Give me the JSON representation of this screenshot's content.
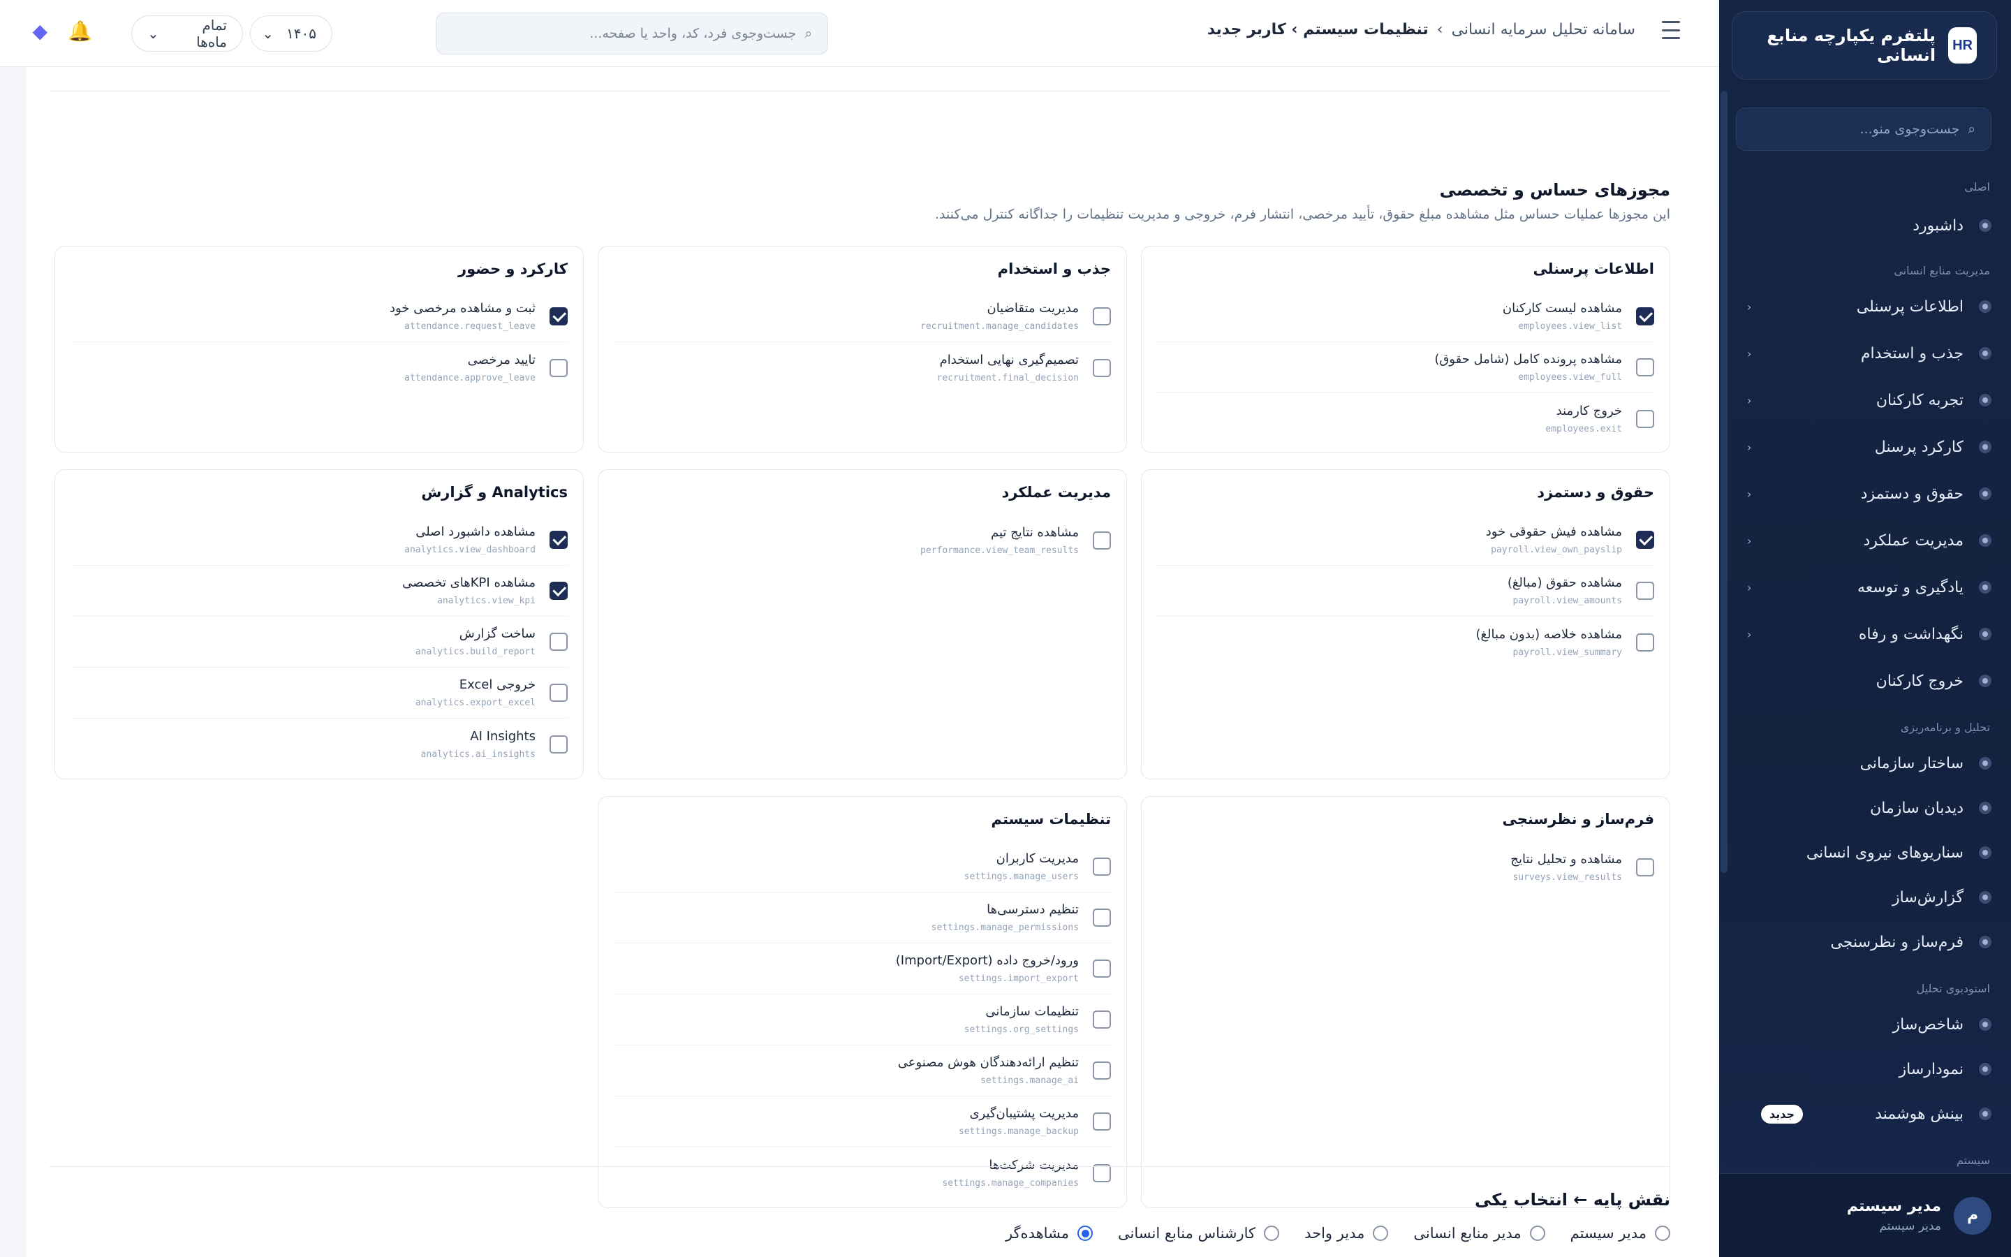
{
  "sidebar": {
    "brand_logo": "HR",
    "brand_title": "پلتفرم یکپارچه منابع انسانی",
    "search_placeholder": "جست‌وجوی منو...",
    "sections": {
      "main": "اصلی",
      "hr": "مدیریت منابع انسانی",
      "analysis": "تحلیل و برنامه‌ریزی",
      "studio": "استودیوی تحلیل",
      "system": "سیستم"
    },
    "items": {
      "dashboard": "داشبورد",
      "personnel": "اطلاعات پرسنلی",
      "recruitment": "جذب و استخدام",
      "experience": "تجربه کارکنان",
      "attendance": "کارکرد پرسنل",
      "payroll": "حقوق و دستمزد",
      "performance": "مدیریت عملکرد",
      "learning": "یادگیری و توسعه",
      "retention": "نگهداشت و رفاه",
      "exit": "خروج کارکنان",
      "org": "ساختار سازمانی",
      "orgview": "دیدبان سازمان",
      "scenarios": "سناریوهای نیروی انسانی",
      "reports": "گزارش‌ساز",
      "forms": "فرم‌ساز و نظرسنجی",
      "kpi": "شاخص‌ساز",
      "charts": "نمودارساز",
      "insight": "بینش هوشمند"
    },
    "new_badge": "جدید",
    "user": {
      "initial": "م",
      "name": "مدیر سیستم",
      "role": "مدیر سیستم"
    }
  },
  "header": {
    "breadcrumb_root": "سامانه تحلیل سرمایه انسانی",
    "breadcrumb_sep": "›",
    "breadcrumb_current": "تنظیمات سیستم › کاربر جدید",
    "search_placeholder": "جست‌وجوی فرد، کد، واحد یا صفحه...",
    "year": "۱۴۰۵",
    "period": "تمام ماه‌ها"
  },
  "permissions": {
    "title": "مجوزهای حساس و تخصصی",
    "description": "این مجوزها عملیات حساس مثل مشاهده مبلغ حقوق، تأیید مرخصی، انتشار فرم، خروجی و مدیریت تنظیمات را جداگانه کنترل می‌کنند.",
    "groups": {
      "personnel": {
        "title": "اطلاعات پرسنلی",
        "items": [
          {
            "label": "مشاهده لیست کارکنان",
            "code": "employees.view_list",
            "checked": true
          },
          {
            "label": "مشاهده پرونده کامل (شامل حقوق)",
            "code": "employees.view_full",
            "checked": false
          },
          {
            "label": "خروج کارمند",
            "code": "employees.exit",
            "checked": false
          }
        ]
      },
      "recruitment": {
        "title": "جذب و استخدام",
        "items": [
          {
            "label": "مدیریت متقاضیان",
            "code": "recruitment.manage_candidates",
            "checked": false
          },
          {
            "label": "تصمیم‌گیری نهایی استخدام",
            "code": "recruitment.final_decision",
            "checked": false
          }
        ]
      },
      "attendance": {
        "title": "کارکرد و حضور",
        "items": [
          {
            "label": "ثبت و مشاهده مرخصی خود",
            "code": "attendance.request_leave",
            "checked": true
          },
          {
            "label": "تایید مرخصی",
            "code": "attendance.approve_leave",
            "checked": false
          }
        ]
      },
      "payroll": {
        "title": "حقوق و دستمزد",
        "items": [
          {
            "label": "مشاهده فیش حقوقی خود",
            "code": "payroll.view_own_payslip",
            "checked": true
          },
          {
            "label": "مشاهده حقوق (مبالغ)",
            "code": "payroll.view_amounts",
            "checked": false
          },
          {
            "label": "مشاهده خلاصه (بدون مبالغ)",
            "code": "payroll.view_summary",
            "checked": false
          }
        ]
      },
      "performance": {
        "title": "مدیریت عملکرد",
        "items": [
          {
            "label": "مشاهده نتایج تیم",
            "code": "performance.view_team_results",
            "checked": false
          }
        ]
      },
      "analytics": {
        "title": "Analytics و گزارش",
        "items": [
          {
            "label": "مشاهده داشبورد اصلی",
            "code": "analytics.view_dashboard",
            "checked": true
          },
          {
            "label": "مشاهده KPIهای تخصصی",
            "code": "analytics.view_kpi",
            "checked": true
          },
          {
            "label": "ساخت گزارش",
            "code": "analytics.build_report",
            "checked": false
          },
          {
            "label": "خروجی Excel",
            "code": "analytics.export_excel",
            "checked": false
          },
          {
            "label": "AI Insights",
            "code": "analytics.ai_insights",
            "checked": false
          }
        ]
      },
      "surveys": {
        "title": "فرم‌ساز و نظرسنجی",
        "items": [
          {
            "label": "مشاهده و تحلیل نتایج",
            "code": "surveys.view_results",
            "checked": false
          }
        ]
      },
      "settings": {
        "title": "تنظیمات سیستم",
        "items": [
          {
            "label": "مدیریت کاربران",
            "code": "settings.manage_users",
            "checked": false
          },
          {
            "label": "تنظیم دسترسی‌ها",
            "code": "settings.manage_permissions",
            "checked": false
          },
          {
            "label": "ورود/خروج داده (Import/Export)",
            "code": "settings.import_export",
            "checked": false
          },
          {
            "label": "تنظیمات سازمانی",
            "code": "settings.org_settings",
            "checked": false
          },
          {
            "label": "تنظیم ارائه‌دهندگان هوش مصنوعی",
            "code": "settings.manage_ai",
            "checked": false
          },
          {
            "label": "مدیریت پشتیبان‌گیری",
            "code": "settings.manage_backup",
            "checked": false
          },
          {
            "label": "مدیریت شرکت‌ها",
            "code": "settings.manage_companies",
            "checked": false
          }
        ]
      }
    }
  },
  "base_role": {
    "title": "نقش پایه ← انتخاب یکی",
    "options": [
      {
        "label": "مدیر سیستم",
        "selected": false
      },
      {
        "label": "مدیر منابع انسانی",
        "selected": false
      },
      {
        "label": "مدیر واحد",
        "selected": false
      },
      {
        "label": "کارشناس منابع انسانی",
        "selected": false
      },
      {
        "label": "مشاهده‌گر",
        "selected": true
      }
    ]
  },
  "icons": {
    "search": "search-icon",
    "bell": "bell-icon",
    "moon": "moon-icon",
    "ai": "ai-icon",
    "logout": "logout-icon"
  },
  "colors": {
    "sidebar_bg": "#142544",
    "checkbox_on": "#1e2d55",
    "radio_on": "#2563eb"
  }
}
